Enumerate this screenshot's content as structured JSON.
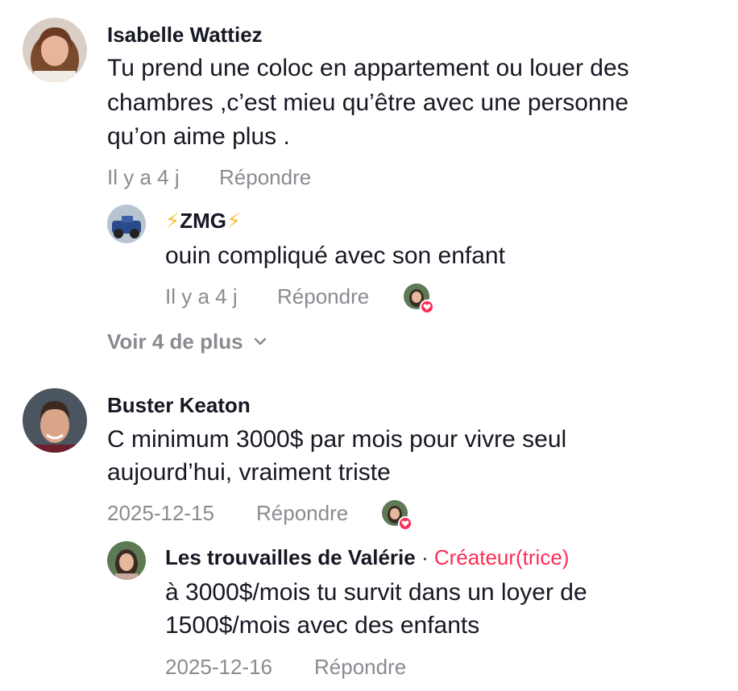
{
  "comments": [
    {
      "username": "Isabelle Wattiez",
      "text_lines": [
        "Tu prend une coloc en appartement ou louer des",
        "chambres ,c’est mieu qu’être avec une personne",
        "qu’on aime plus ."
      ],
      "time": "Il y a 4 j",
      "reply_label": "Répondre",
      "replies": [
        {
          "bolt": "⚡",
          "username": "ZMG",
          "text": "ouin compliqué avec son enfant",
          "time": "Il y a 4 j",
          "reply_label": "Répondre",
          "creator_liked": true
        }
      ],
      "view_more": "Voir 4 de plus"
    },
    {
      "username": "Buster Keaton",
      "text_lines": [
        "C minimum 3000$ par mois pour vivre seul",
        "aujourd’hui, vraiment triste"
      ],
      "time": "2025-12-15",
      "reply_label": "Répondre",
      "creator_liked": true,
      "replies": [
        {
          "username": "Les trouvailles de Valérie",
          "separator": "·",
          "badge": "Créateur(trice)",
          "text_lines": [
            "à 3000$/mois tu survit dans un loyer de",
            "1500$/mois avec des enfants"
          ],
          "time": "2025-12-16",
          "reply_label": "Répondre"
        }
      ]
    }
  ],
  "colors": {
    "text": "#161823",
    "muted": "#8a8b91",
    "creator": "#fe2c55",
    "heart": "#fe2c55"
  },
  "icons": {
    "chevron": "chevron-down-icon",
    "heart": "heart-icon"
  }
}
